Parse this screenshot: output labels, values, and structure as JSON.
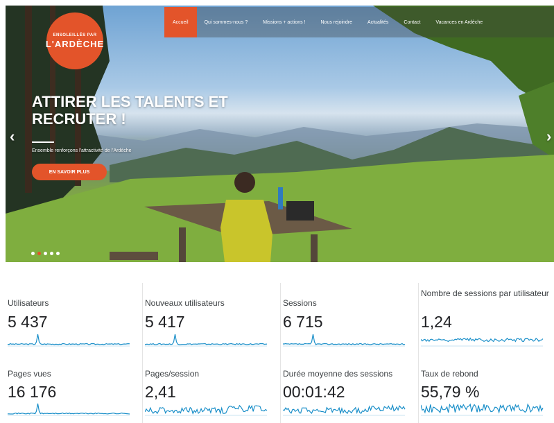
{
  "logo": {
    "line1": "ENSOLEILLÉS PAR",
    "line2": "L'ARDÈCHE"
  },
  "nav": {
    "items": [
      {
        "label": "Accueil",
        "active": true
      },
      {
        "label": "Qui sommes-nous ?",
        "active": false
      },
      {
        "label": "Missions + actions !",
        "active": false
      },
      {
        "label": "Nous rejoindre",
        "active": false
      },
      {
        "label": "Actualités",
        "active": false
      },
      {
        "label": "Contact",
        "active": false
      },
      {
        "label": "Vacances en Ardèche",
        "active": false
      }
    ]
  },
  "hero": {
    "title": "ATTIRER LES TALENTS ET RECRUTER !",
    "subtitle": "Ensemble renforçons l'attractivité de l'Ardèche",
    "button": "EN SAVOIR PLUS",
    "arrow_left": "‹",
    "arrow_right": "›",
    "slide_count": 5,
    "active_slide": 2
  },
  "colors": {
    "accent": "#e3542a",
    "sparkline": "#1a8fc9"
  },
  "metrics": [
    {
      "label": "Utilisateurs",
      "value": "5 437",
      "trend": "spike"
    },
    {
      "label": "Nouveaux utilisateurs",
      "value": "5 417",
      "trend": "spike"
    },
    {
      "label": "Sessions",
      "value": "6 715",
      "trend": "spike"
    },
    {
      "label": "Nombre de sessions par utilisateur",
      "value": "1,24",
      "trend": "flat-noisy"
    },
    {
      "label": "Pages vues",
      "value": "16 176",
      "trend": "spike"
    },
    {
      "label": "Pages/session",
      "value": "2,41",
      "trend": "noisy"
    },
    {
      "label": "Durée moyenne des sessions",
      "value": "00:01:42",
      "trend": "noisy"
    },
    {
      "label": "Taux de rebond",
      "value": "55,79 %",
      "trend": "very-noisy"
    }
  ]
}
